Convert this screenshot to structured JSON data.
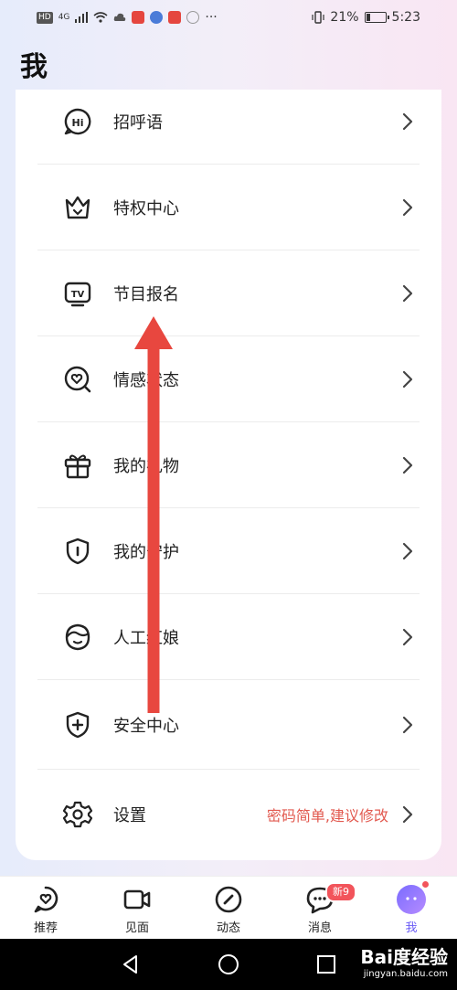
{
  "status_bar": {
    "network": "HD",
    "signal": "4G",
    "more": "···",
    "battery_percent": "21%",
    "battery_level": 0.21,
    "time": "5:23"
  },
  "page": {
    "title": "我"
  },
  "menu": {
    "items": [
      {
        "label": "招呼语",
        "icon": "hi-icon"
      },
      {
        "label": "特权中心",
        "icon": "crown-icon"
      },
      {
        "label": "节目报名",
        "icon": "tv-icon"
      },
      {
        "label": "情感状态",
        "icon": "heart-search-icon"
      },
      {
        "label": "我的礼物",
        "icon": "gift-icon"
      },
      {
        "label": "我的守护",
        "icon": "shield-icon"
      },
      {
        "label": "人工红娘",
        "icon": "matchmaker-icon"
      },
      {
        "label": "安全中心",
        "icon": "shield-plus-icon"
      },
      {
        "label": "设置",
        "icon": "gear-icon",
        "hint": "密码简单,建议修改"
      }
    ]
  },
  "bottom_nav": {
    "items": [
      {
        "label": "推荐",
        "icon": "heart-chat-icon"
      },
      {
        "label": "见面",
        "icon": "video-icon"
      },
      {
        "label": "动态",
        "icon": "compass-icon"
      },
      {
        "label": "消息",
        "icon": "message-icon",
        "badge": "新9"
      },
      {
        "label": "我",
        "icon": "avatar-icon",
        "active": true
      }
    ]
  },
  "watermark": {
    "logo": "Bai度经验",
    "url": "jingyan.baidu.com"
  },
  "colors": {
    "accent": "#6b5cf6",
    "hint_red": "#e2594f",
    "badge_red": "#f2545b",
    "arrow_red": "#e8473f"
  }
}
